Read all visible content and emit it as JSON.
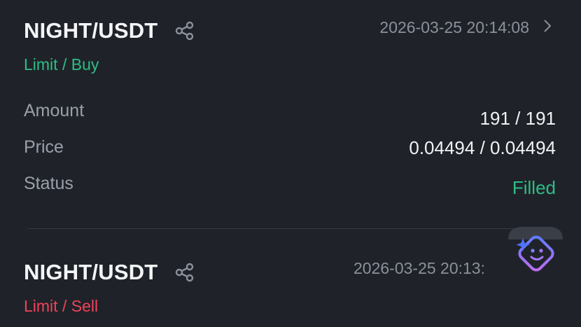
{
  "orders": [
    {
      "pair": "NIGHT/USDT",
      "datetime": "2026-03-25 20:14:08",
      "type": "Limit / Buy",
      "rows": {
        "amount": {
          "label": "Amount",
          "value": "191 / 191"
        },
        "price": {
          "label": "Price",
          "value": "0.04494 / 0.04494"
        },
        "status": {
          "label": "Status",
          "value": "Filled"
        }
      }
    },
    {
      "pair": "NIGHT/USDT",
      "datetime": "2026-03-25 20:13:",
      "type": "Limit / Sell"
    }
  ],
  "colors": {
    "background": "#1f2329",
    "buy": "#2ebd85",
    "sell": "#f0425a",
    "filled": "#2ebd85",
    "muted": "#8b919b"
  },
  "icons": {
    "share": "share-icon",
    "detail": "chevron-right-icon",
    "assistant": "ai-assistant-icon"
  }
}
